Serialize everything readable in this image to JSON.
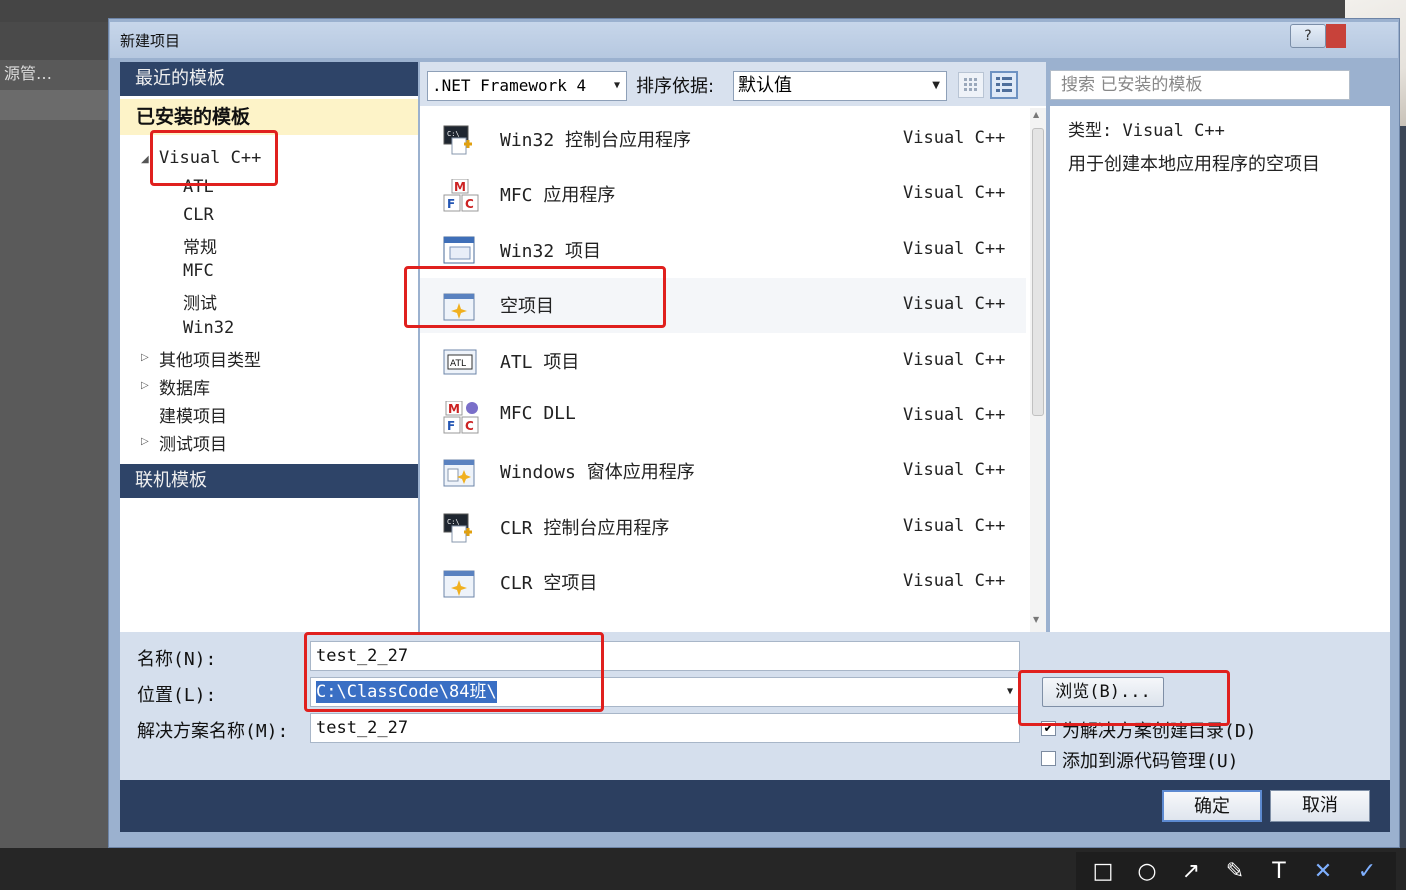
{
  "background": {
    "side_label": "源管…"
  },
  "dialog": {
    "title": "新建项目",
    "help_label": "?"
  },
  "nav": {
    "recent": "最近的模板",
    "installed": "已安装的模板",
    "online": "联机模板",
    "tree": [
      {
        "label": "Visual C++",
        "level": 0,
        "expander": "◢"
      },
      {
        "label": "ATL",
        "level": 1
      },
      {
        "label": "CLR",
        "level": 1
      },
      {
        "label": "常规",
        "level": 1
      },
      {
        "label": "MFC",
        "level": 1
      },
      {
        "label": "测试",
        "level": 1
      },
      {
        "label": "Win32",
        "level": 1
      },
      {
        "label": "其他项目类型",
        "level": 0,
        "expander": "▷"
      },
      {
        "label": "数据库",
        "level": 0,
        "expander": "▷"
      },
      {
        "label": "建模项目",
        "level": 0
      },
      {
        "label": "测试项目",
        "level": 0,
        "expander": "▷"
      }
    ]
  },
  "toolbar": {
    "framework": ".NET Framework 4",
    "sort_label": "排序依据:",
    "sort_value": "默认值",
    "search_placeholder": "搜索 已安装的模板"
  },
  "templates": [
    {
      "name": "Win32 控制台应用程序",
      "lang": "Visual C++",
      "icon": "console-app-icon"
    },
    {
      "name": "MFC 应用程序",
      "lang": "Visual C++",
      "icon": "mfc-icon"
    },
    {
      "name": "Win32 项目",
      "lang": "Visual C++",
      "icon": "window-app-icon"
    },
    {
      "name": "空项目",
      "lang": "Visual C++",
      "icon": "empty-project-icon",
      "selected": true
    },
    {
      "name": "ATL 项目",
      "lang": "Visual C++",
      "icon": "atl-icon"
    },
    {
      "name": "MFC DLL",
      "lang": "Visual C++",
      "icon": "mfc-dll-icon"
    },
    {
      "name": "Windows 窗体应用程序",
      "lang": "Visual C++",
      "icon": "forms-app-icon"
    },
    {
      "name": "CLR 控制台应用程序",
      "lang": "Visual C++",
      "icon": "console-app-icon"
    },
    {
      "name": "CLR 空项目",
      "lang": "Visual C++",
      "icon": "empty-project-icon"
    }
  ],
  "details": {
    "type": "类型: Visual C++",
    "description": "用于创建本地应用程序的空项目"
  },
  "form": {
    "name_label": "名称(N):",
    "name_value": "test_2_27",
    "location_label": "位置(L):",
    "location_value": "C:\\ClassCode\\84班\\",
    "solution_label": "解决方案名称(M):",
    "solution_value": "test_2_27",
    "browse_label": "浏览(B)...",
    "create_dir_label": "为解决方案创建目录(D)",
    "create_dir_checked": true,
    "source_control_label": "添加到源代码管理(U)",
    "source_control_checked": false
  },
  "buttons": {
    "ok": "确定",
    "cancel": "取消"
  },
  "colors": {
    "annotation": "#e0201e",
    "nav_header": "#2e4468",
    "installed_highlight": "#fdf3c8"
  },
  "annotation_tools": [
    "rectangle-icon",
    "circle-icon",
    "arrow-icon",
    "brush-icon",
    "text-icon",
    "cancel-icon",
    "confirm-icon"
  ]
}
